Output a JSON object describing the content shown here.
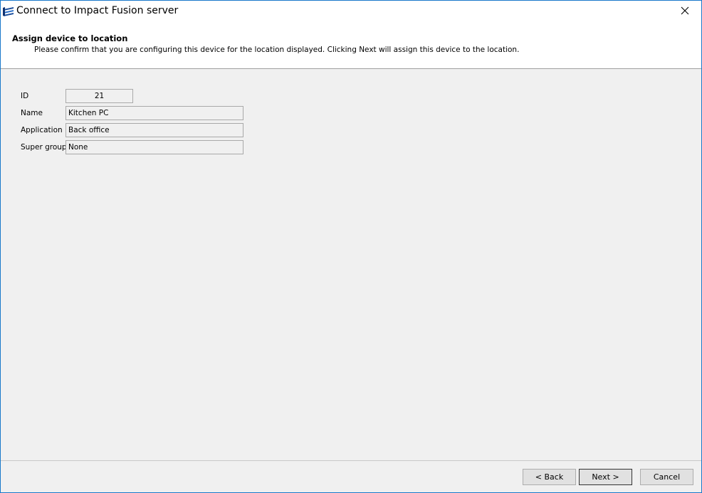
{
  "window": {
    "title": "Connect to Impact Fusion server",
    "icon": "app-logo-icon",
    "close_icon": "close-icon"
  },
  "header": {
    "title": "Assign device to location",
    "description": "Please confirm that you are configuring this device for the location displayed. Clicking Next will assign this device to the location."
  },
  "form": {
    "id_label": "ID",
    "id_value": "21",
    "name_label": "Name",
    "name_value": "Kitchen PC",
    "application_label": "Application",
    "application_value": "Back office",
    "supergroup_label": "Super group",
    "supergroup_value": "None"
  },
  "footer": {
    "back_label": "< Back",
    "next_label": "Next >",
    "cancel_label": "Cancel"
  },
  "colors": {
    "window_border": "#1979ca",
    "body_background": "#f0f0f0",
    "header_background": "#ffffff"
  }
}
